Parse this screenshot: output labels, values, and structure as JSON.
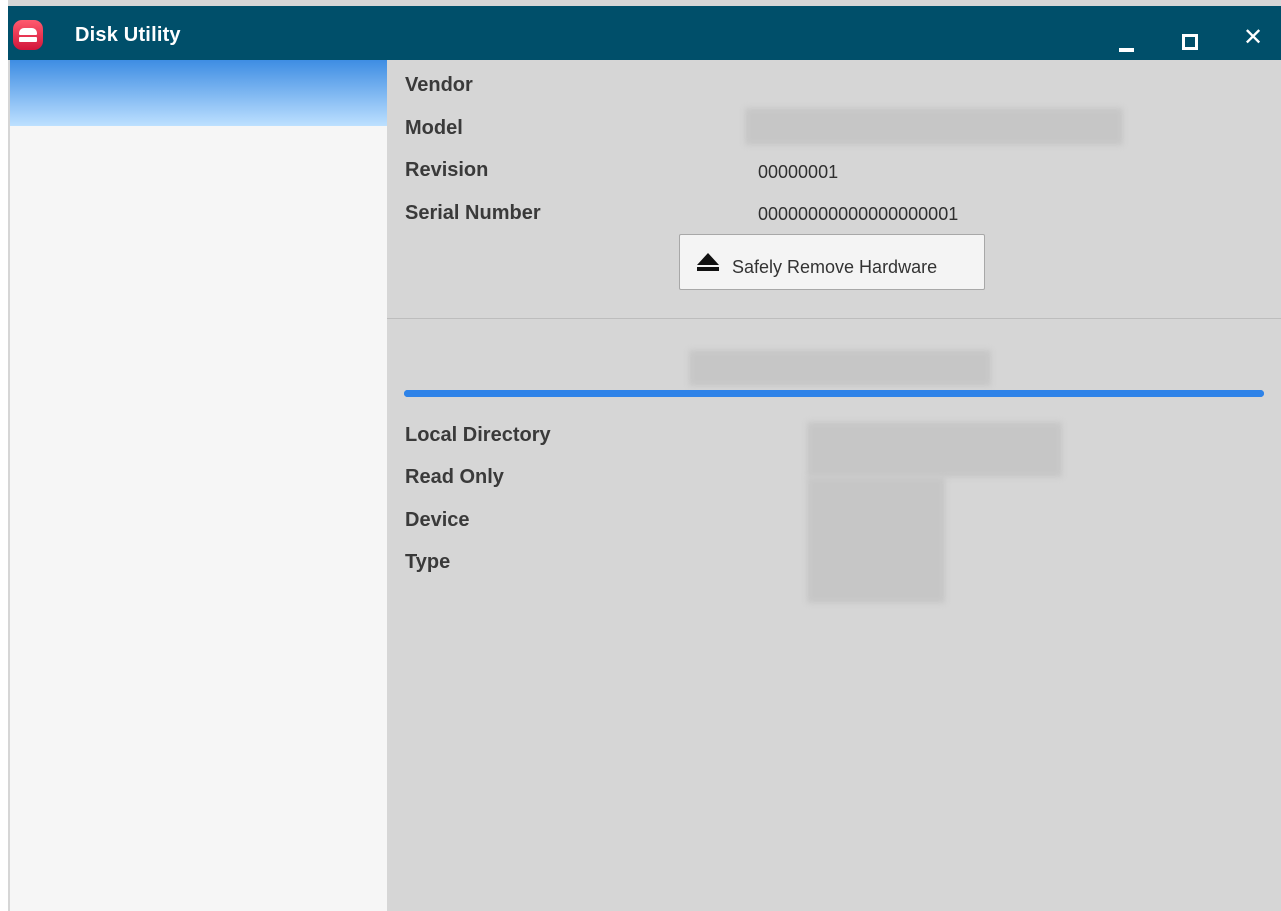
{
  "window": {
    "title": "Disk Utility"
  },
  "titlebar": {
    "controls": {
      "minimize": "minimize",
      "maximize": "maximize",
      "close": "✕"
    }
  },
  "sidebar": {
    "selected_index": 0
  },
  "drive_info": {
    "rows": [
      {
        "label": "Vendor",
        "value": ""
      },
      {
        "label": "Model",
        "value": ""
      },
      {
        "label": "Revision",
        "value": "00000001"
      },
      {
        "label": "Serial Number",
        "value": "00000000000000000001"
      }
    ],
    "eject_button": {
      "label": "Safely Remove Hardware",
      "icon": "eject-icon"
    }
  },
  "volume": {
    "name": "",
    "usage_fraction": 1.0,
    "rows": [
      {
        "label": "Local Directory",
        "value": ""
      },
      {
        "label": "Read Only",
        "value": ""
      },
      {
        "label": "Device",
        "value": ""
      },
      {
        "label": "Type",
        "value": ""
      }
    ]
  },
  "colors": {
    "titlebar": "#004f6a",
    "selection": "#3e8de3",
    "progress": "#2f83e8",
    "app_icon": "#e02645"
  }
}
